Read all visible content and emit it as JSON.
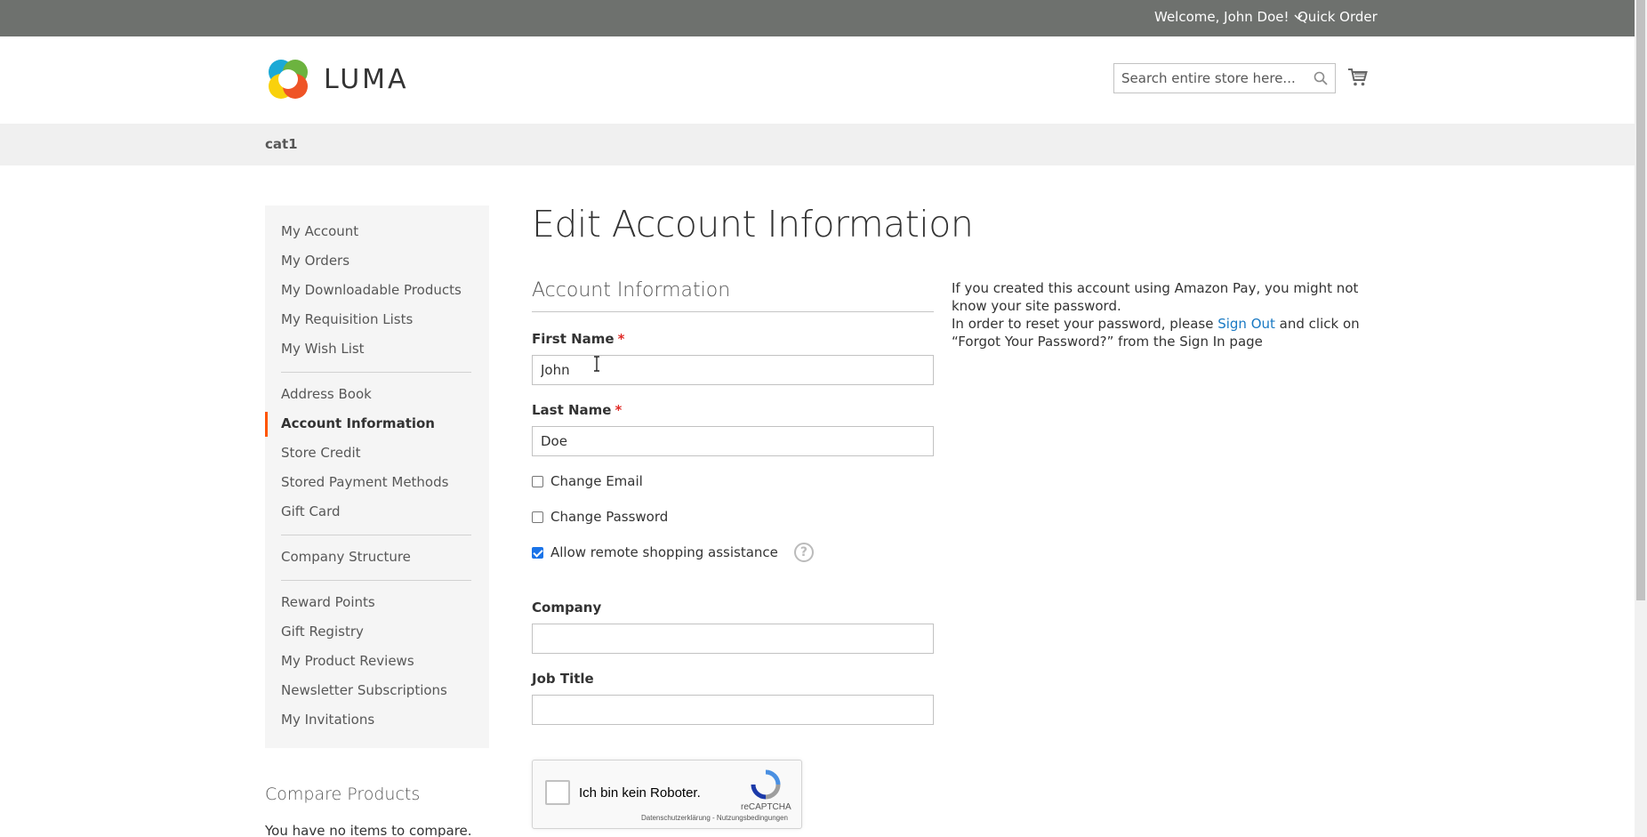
{
  "topbar": {
    "welcome": "Welcome, John Doe!",
    "quick_order": "Quick Order"
  },
  "header": {
    "logo_text": "LUMA",
    "search_placeholder": "Search entire store here...",
    "search_value": ""
  },
  "nav": {
    "category": "cat1"
  },
  "sidebar": {
    "items": [
      {
        "label": "My Account"
      },
      {
        "label": "My Orders"
      },
      {
        "label": "My Downloadable Products"
      },
      {
        "label": "My Requisition Lists"
      },
      {
        "label": "My Wish List"
      },
      {
        "label": "Address Book"
      },
      {
        "label": "Account Information",
        "active": true
      },
      {
        "label": "Store Credit"
      },
      {
        "label": "Stored Payment Methods"
      },
      {
        "label": "Gift Card"
      },
      {
        "label": "Company Structure"
      },
      {
        "label": "Reward Points"
      },
      {
        "label": "Gift Registry"
      },
      {
        "label": "My Product Reviews"
      },
      {
        "label": "Newsletter Subscriptions"
      },
      {
        "label": "My Invitations"
      }
    ],
    "accent_color": "#ff5501"
  },
  "compare": {
    "title": "Compare Products",
    "empty_text": "You have no items to compare."
  },
  "main": {
    "page_title": "Edit Account Information",
    "section_title": "Account Information",
    "first_name": {
      "label": "First Name",
      "required": "*",
      "value": "John"
    },
    "last_name": {
      "label": "Last Name",
      "required": "*",
      "value": "Doe"
    },
    "change_email": {
      "label": "Change Email",
      "checked": false
    },
    "change_password": {
      "label": "Change Password",
      "checked": false
    },
    "remote_assistance": {
      "label": "Allow remote shopping assistance",
      "checked": true,
      "help_icon": "?"
    },
    "company": {
      "label": "Company",
      "value": ""
    },
    "job_title": {
      "label": "Job Title",
      "value": ""
    },
    "note": {
      "line1": "If you created this account using Amazon Pay, you might not know your site password.",
      "line2_before": "In order to reset your password, please ",
      "link": "Sign Out",
      "line2_after": " and click on “Forgot Your Password?” from the Sign In page"
    }
  },
  "recaptcha": {
    "label": "Ich bin kein Roboter.",
    "brand": "reCAPTCHA",
    "links": "Datenschutzerklärung - Nutzungsbedingungen"
  },
  "colors": {
    "topbar_bg": "#6e716e",
    "link": "#1979c3",
    "required": "#e02b27",
    "checkbox_checked": "#1a73e8"
  }
}
